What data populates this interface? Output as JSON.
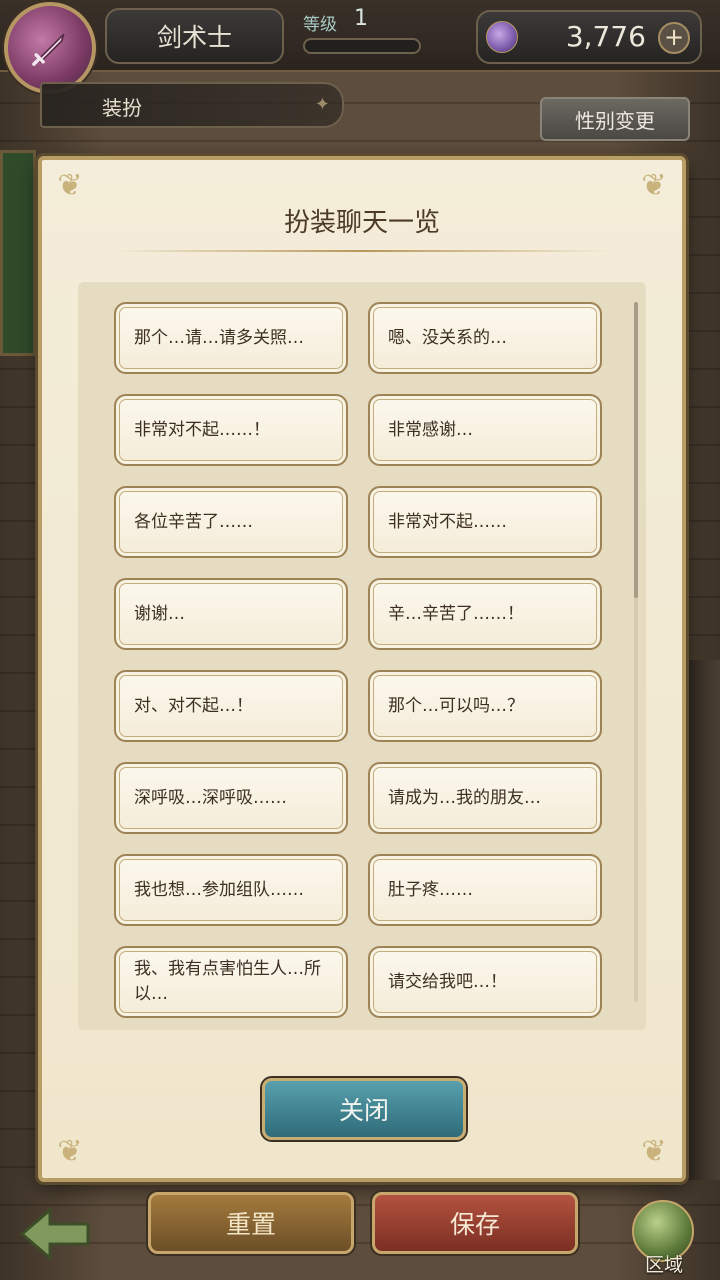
{
  "header": {
    "class_name": "剑术士",
    "level_label": "等级",
    "level_value": "1",
    "level_progress": 0.0,
    "currency_value": "3,776",
    "plus_symbol": "+"
  },
  "section": {
    "tab_label": "装扮",
    "gender_button_label": "性别变更"
  },
  "dialog": {
    "title": "扮装聊天一览",
    "close_label": "关闭",
    "options": [
      "那个…请…请多关照…",
      "嗯、没关系的…",
      "非常对不起……！",
      "非常感谢…",
      "各位辛苦了……",
      "非常对不起……",
      "谢谢…",
      "辛…辛苦了……！",
      "对、对不起…！",
      "那个…可以吗…？",
      "深呼吸…深呼吸……",
      "请成为…我的朋友…",
      "我也想…参加组队……",
      "肚子疼……",
      "我、我有点害怕生人…所以…",
      "请交给我吧…！"
    ]
  },
  "footer": {
    "reset_label": "重置",
    "save_label": "保存",
    "region_label": "区域"
  },
  "colors": {
    "dialog_bg": "#f4edd9",
    "close_button": "#2f6b79",
    "save_button": "#b4523f",
    "reset_button": "#a47a3d"
  },
  "icons": {
    "class_emblem": "sword-icon",
    "currency": "gem-icon",
    "back": "back-arrow-icon",
    "region": "globe-icon"
  }
}
